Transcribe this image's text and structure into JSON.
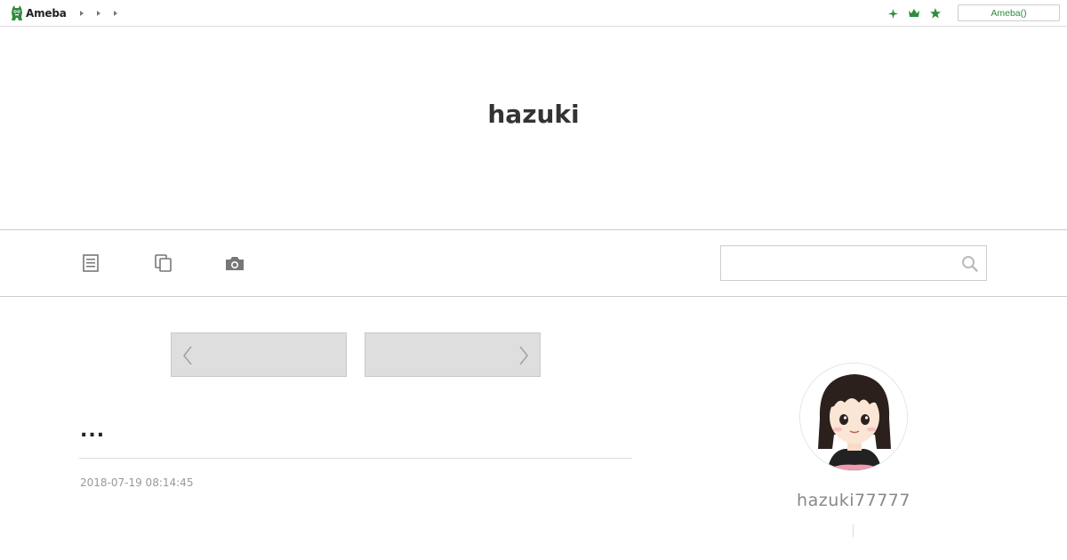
{
  "topbar": {
    "logo_text": "Ameba",
    "breadcrumbs": [
      "",
      "",
      ""
    ],
    "icons": [
      "sparkle-icon",
      "crown-icon",
      "star-icon"
    ],
    "login_label": "Ameba()",
    "accent_color": "#2d8c3c"
  },
  "header": {
    "blog_title": "hazuki"
  },
  "nav": {
    "icons": [
      "entry-list-icon",
      "theme-list-icon",
      "camera-icon"
    ],
    "search": {
      "placeholder": "",
      "value": ""
    }
  },
  "pager": {
    "prev_icon": "chevron-left-icon",
    "next_icon": "chevron-right-icon"
  },
  "entry": {
    "title": "...",
    "date": "2018-07-19 08:14:45"
  },
  "profile": {
    "name": "hazuki77777"
  }
}
